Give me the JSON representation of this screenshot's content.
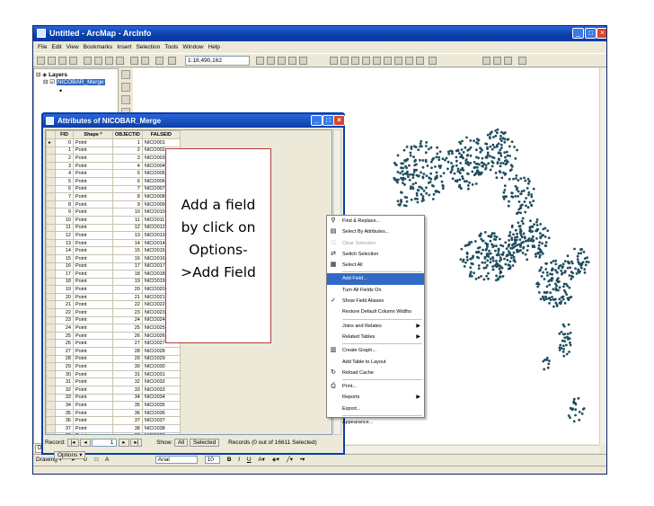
{
  "window": {
    "title": "Untitled - ArcMap - ArcInfo"
  },
  "menus": [
    "File",
    "Edit",
    "View",
    "Bookmarks",
    "Insert",
    "Selection",
    "Tools",
    "Window",
    "Help"
  ],
  "toolbar": {
    "scale": "1:18,490,162"
  },
  "toc": {
    "root": "Layers",
    "layer": "NICOBAR_Merge"
  },
  "toc_tabs": [
    "Display",
    "Source",
    "Selection"
  ],
  "attributes": {
    "title": "Attributes of NICOBAR_Merge",
    "columns": [
      "FID",
      "Shape *",
      "OBJECTID",
      "FALSEID"
    ],
    "rows": [
      [
        "0",
        "Point",
        "1",
        "NICO001"
      ],
      [
        "1",
        "Point",
        "2",
        "NICO002"
      ],
      [
        "2",
        "Point",
        "3",
        "NICO003"
      ],
      [
        "3",
        "Point",
        "4",
        "NICO004"
      ],
      [
        "4",
        "Point",
        "5",
        "NICO005"
      ],
      [
        "5",
        "Point",
        "6",
        "NICO006"
      ],
      [
        "6",
        "Point",
        "7",
        "NICO007"
      ],
      [
        "7",
        "Point",
        "8",
        "NICO008"
      ],
      [
        "8",
        "Point",
        "9",
        "NICO009"
      ],
      [
        "9",
        "Point",
        "10",
        "NICO010"
      ],
      [
        "10",
        "Point",
        "11",
        "NICO011"
      ],
      [
        "11",
        "Point",
        "12",
        "NICO012"
      ],
      [
        "12",
        "Point",
        "13",
        "NICO013"
      ],
      [
        "13",
        "Point",
        "14",
        "NICO014"
      ],
      [
        "14",
        "Point",
        "15",
        "NICO015"
      ],
      [
        "15",
        "Point",
        "16",
        "NICO016"
      ],
      [
        "16",
        "Point",
        "17",
        "NICO017"
      ],
      [
        "17",
        "Point",
        "18",
        "NICO018"
      ],
      [
        "18",
        "Point",
        "19",
        "NICO019"
      ],
      [
        "19",
        "Point",
        "20",
        "NICO020"
      ],
      [
        "20",
        "Point",
        "21",
        "NICO021"
      ],
      [
        "21",
        "Point",
        "22",
        "NICO022"
      ],
      [
        "22",
        "Point",
        "23",
        "NICO023"
      ],
      [
        "23",
        "Point",
        "24",
        "NICO024"
      ],
      [
        "24",
        "Point",
        "25",
        "NICO025"
      ],
      [
        "25",
        "Point",
        "26",
        "NICO026"
      ],
      [
        "26",
        "Point",
        "27",
        "NICO027"
      ],
      [
        "27",
        "Point",
        "28",
        "NICO028"
      ],
      [
        "28",
        "Point",
        "29",
        "NICO029"
      ],
      [
        "29",
        "Point",
        "30",
        "NICO030"
      ],
      [
        "30",
        "Point",
        "31",
        "NICO031"
      ],
      [
        "31",
        "Point",
        "32",
        "NICO032"
      ],
      [
        "32",
        "Point",
        "33",
        "NICO033"
      ],
      [
        "33",
        "Point",
        "34",
        "NICO034"
      ],
      [
        "34",
        "Point",
        "35",
        "NICO035"
      ],
      [
        "35",
        "Point",
        "36",
        "NICO036"
      ],
      [
        "36",
        "Point",
        "37",
        "NICO037"
      ],
      [
        "37",
        "Point",
        "38",
        "NICO038"
      ],
      [
        "38",
        "Point",
        "39",
        "NICO039"
      ]
    ],
    "record_label": "Record:",
    "record_value": "1",
    "show_label": "Show:",
    "show_all": "All",
    "show_selected": "Selected",
    "records_text": "Records (0 out of 16611 Selected)",
    "options": "Options ▾"
  },
  "annotation": {
    "lines": [
      "Add a field",
      "by click on",
      "Options-",
      ">Add Field"
    ]
  },
  "context_menu": [
    {
      "label": "Find & Replace...",
      "icon": "binoculars-icon",
      "glyph": "⚲"
    },
    {
      "label": "Select By Attributes...",
      "icon": "table-select-icon",
      "glyph": "▤"
    },
    {
      "label": "Clear Selection",
      "icon": "clear-selection-icon",
      "glyph": "□",
      "disabled": true
    },
    {
      "label": "Switch Selection",
      "icon": "switch-selection-icon",
      "glyph": "⇄"
    },
    {
      "label": "Select All",
      "icon": "select-all-icon",
      "glyph": "▦"
    },
    {
      "label": "Add Field...",
      "highlight": true
    },
    {
      "label": "Turn All Fields On"
    },
    {
      "label": "Show Field Aliases",
      "icon": "check-icon",
      "glyph": "✓"
    },
    {
      "label": "Restore Default Column Widths"
    },
    {
      "label": "Joins and Relates",
      "submenu": true
    },
    {
      "label": "Related Tables",
      "submenu": true
    },
    {
      "label": "Create Graph...",
      "icon": "graph-icon",
      "glyph": "▥"
    },
    {
      "label": "Add Table to Layout"
    },
    {
      "label": "Reload Cache",
      "icon": "reload-icon",
      "glyph": "↻"
    },
    {
      "label": "Print...",
      "icon": "print-icon",
      "glyph": "⎙"
    },
    {
      "label": "Reports",
      "submenu": true
    },
    {
      "label": "Export..."
    },
    {
      "label": "Appearance..."
    }
  ],
  "drawbar": {
    "drawing": "Drawing ▾",
    "font": "Arial",
    "size": "10",
    "bold": "B",
    "italic": "I",
    "underline": "U"
  },
  "colors": {
    "titlebar": "#0a3ea8",
    "highlight": "#316ac5",
    "point": "#1f4e5e"
  }
}
